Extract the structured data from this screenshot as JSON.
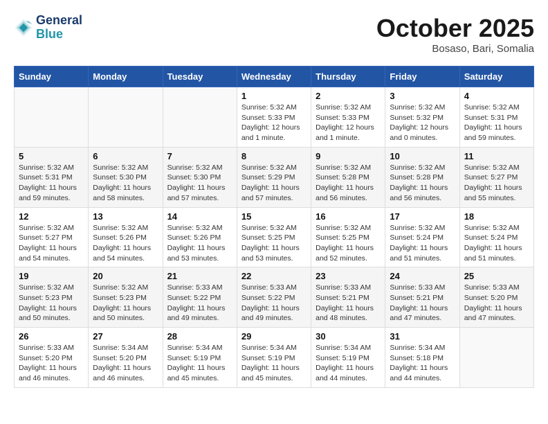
{
  "logo": {
    "text_general": "General",
    "text_blue": "Blue"
  },
  "header": {
    "month": "October 2025",
    "location": "Bosaso, Bari, Somalia"
  },
  "weekdays": [
    "Sunday",
    "Monday",
    "Tuesday",
    "Wednesday",
    "Thursday",
    "Friday",
    "Saturday"
  ],
  "weeks": [
    [
      {
        "day": "",
        "info": ""
      },
      {
        "day": "",
        "info": ""
      },
      {
        "day": "",
        "info": ""
      },
      {
        "day": "1",
        "info": "Sunrise: 5:32 AM\nSunset: 5:33 PM\nDaylight: 12 hours\nand 1 minute."
      },
      {
        "day": "2",
        "info": "Sunrise: 5:32 AM\nSunset: 5:33 PM\nDaylight: 12 hours\nand 1 minute."
      },
      {
        "day": "3",
        "info": "Sunrise: 5:32 AM\nSunset: 5:32 PM\nDaylight: 12 hours\nand 0 minutes."
      },
      {
        "day": "4",
        "info": "Sunrise: 5:32 AM\nSunset: 5:31 PM\nDaylight: 11 hours\nand 59 minutes."
      }
    ],
    [
      {
        "day": "5",
        "info": "Sunrise: 5:32 AM\nSunset: 5:31 PM\nDaylight: 11 hours\nand 59 minutes."
      },
      {
        "day": "6",
        "info": "Sunrise: 5:32 AM\nSunset: 5:30 PM\nDaylight: 11 hours\nand 58 minutes."
      },
      {
        "day": "7",
        "info": "Sunrise: 5:32 AM\nSunset: 5:30 PM\nDaylight: 11 hours\nand 57 minutes."
      },
      {
        "day": "8",
        "info": "Sunrise: 5:32 AM\nSunset: 5:29 PM\nDaylight: 11 hours\nand 57 minutes."
      },
      {
        "day": "9",
        "info": "Sunrise: 5:32 AM\nSunset: 5:28 PM\nDaylight: 11 hours\nand 56 minutes."
      },
      {
        "day": "10",
        "info": "Sunrise: 5:32 AM\nSunset: 5:28 PM\nDaylight: 11 hours\nand 56 minutes."
      },
      {
        "day": "11",
        "info": "Sunrise: 5:32 AM\nSunset: 5:27 PM\nDaylight: 11 hours\nand 55 minutes."
      }
    ],
    [
      {
        "day": "12",
        "info": "Sunrise: 5:32 AM\nSunset: 5:27 PM\nDaylight: 11 hours\nand 54 minutes."
      },
      {
        "day": "13",
        "info": "Sunrise: 5:32 AM\nSunset: 5:26 PM\nDaylight: 11 hours\nand 54 minutes."
      },
      {
        "day": "14",
        "info": "Sunrise: 5:32 AM\nSunset: 5:26 PM\nDaylight: 11 hours\nand 53 minutes."
      },
      {
        "day": "15",
        "info": "Sunrise: 5:32 AM\nSunset: 5:25 PM\nDaylight: 11 hours\nand 53 minutes."
      },
      {
        "day": "16",
        "info": "Sunrise: 5:32 AM\nSunset: 5:25 PM\nDaylight: 11 hours\nand 52 minutes."
      },
      {
        "day": "17",
        "info": "Sunrise: 5:32 AM\nSunset: 5:24 PM\nDaylight: 11 hours\nand 51 minutes."
      },
      {
        "day": "18",
        "info": "Sunrise: 5:32 AM\nSunset: 5:24 PM\nDaylight: 11 hours\nand 51 minutes."
      }
    ],
    [
      {
        "day": "19",
        "info": "Sunrise: 5:32 AM\nSunset: 5:23 PM\nDaylight: 11 hours\nand 50 minutes."
      },
      {
        "day": "20",
        "info": "Sunrise: 5:32 AM\nSunset: 5:23 PM\nDaylight: 11 hours\nand 50 minutes."
      },
      {
        "day": "21",
        "info": "Sunrise: 5:33 AM\nSunset: 5:22 PM\nDaylight: 11 hours\nand 49 minutes."
      },
      {
        "day": "22",
        "info": "Sunrise: 5:33 AM\nSunset: 5:22 PM\nDaylight: 11 hours\nand 49 minutes."
      },
      {
        "day": "23",
        "info": "Sunrise: 5:33 AM\nSunset: 5:21 PM\nDaylight: 11 hours\nand 48 minutes."
      },
      {
        "day": "24",
        "info": "Sunrise: 5:33 AM\nSunset: 5:21 PM\nDaylight: 11 hours\nand 47 minutes."
      },
      {
        "day": "25",
        "info": "Sunrise: 5:33 AM\nSunset: 5:20 PM\nDaylight: 11 hours\nand 47 minutes."
      }
    ],
    [
      {
        "day": "26",
        "info": "Sunrise: 5:33 AM\nSunset: 5:20 PM\nDaylight: 11 hours\nand 46 minutes."
      },
      {
        "day": "27",
        "info": "Sunrise: 5:34 AM\nSunset: 5:20 PM\nDaylight: 11 hours\nand 46 minutes."
      },
      {
        "day": "28",
        "info": "Sunrise: 5:34 AM\nSunset: 5:19 PM\nDaylight: 11 hours\nand 45 minutes."
      },
      {
        "day": "29",
        "info": "Sunrise: 5:34 AM\nSunset: 5:19 PM\nDaylight: 11 hours\nand 45 minutes."
      },
      {
        "day": "30",
        "info": "Sunrise: 5:34 AM\nSunset: 5:19 PM\nDaylight: 11 hours\nand 44 minutes."
      },
      {
        "day": "31",
        "info": "Sunrise: 5:34 AM\nSunset: 5:18 PM\nDaylight: 11 hours\nand 44 minutes."
      },
      {
        "day": "",
        "info": ""
      }
    ]
  ]
}
